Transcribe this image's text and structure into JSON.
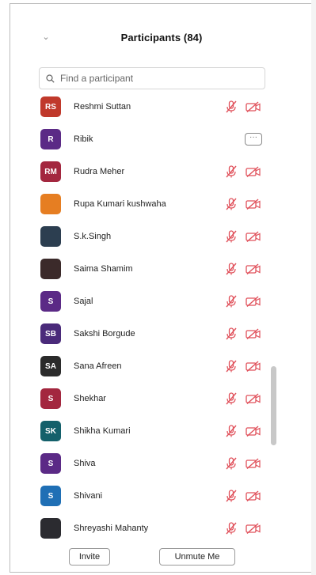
{
  "header": {
    "title": "Participants (84)"
  },
  "search": {
    "placeholder": "Find a participant"
  },
  "participants": [
    {
      "initials": "RS",
      "name": "Reshmi Suttan",
      "color": "#c0392b",
      "controls": "mic-cam"
    },
    {
      "initials": "R",
      "name": "Ribik",
      "color": "#5b2a86",
      "controls": "more"
    },
    {
      "initials": "RM",
      "name": "Rudra Meher",
      "color": "#a3273f",
      "controls": "mic-cam"
    },
    {
      "initials": "",
      "name": "Rupa Kumari kushwaha",
      "color": "#e67e22",
      "controls": "mic-cam"
    },
    {
      "initials": "",
      "name": "S.k.Singh",
      "color": "#2c3e50",
      "controls": "mic-cam"
    },
    {
      "initials": "",
      "name": "Saima Shamim",
      "color": "#3b2a2a",
      "controls": "mic-cam"
    },
    {
      "initials": "S",
      "name": "Sajal",
      "color": "#5b2a86",
      "controls": "mic-cam"
    },
    {
      "initials": "SB",
      "name": "Sakshi Borgude",
      "color": "#4a2a7a",
      "controls": "mic-cam"
    },
    {
      "initials": "SA",
      "name": "Sana Afreen",
      "color": "#2b2b2b",
      "controls": "mic-cam"
    },
    {
      "initials": "S",
      "name": "Shekhar",
      "color": "#a3273f",
      "controls": "mic-cam"
    },
    {
      "initials": "SK",
      "name": "Shikha Kumari",
      "color": "#14606b",
      "controls": "mic-cam"
    },
    {
      "initials": "S",
      "name": "Shiva",
      "color": "#5b2a86",
      "controls": "mic-cam"
    },
    {
      "initials": "S",
      "name": "Shivani",
      "color": "#1f6fb5",
      "controls": "mic-cam"
    },
    {
      "initials": "",
      "name": "Shreyashi Mahanty",
      "color": "#2b2b30",
      "controls": "mic-cam"
    }
  ],
  "footer": {
    "invite_label": "Invite",
    "unmute_label": "Unmute Me"
  },
  "icons": {
    "muted_mic": "muted-mic-icon",
    "video_off": "video-off-icon",
    "more": "more-icon",
    "search": "search-icon",
    "chevron": "chevron-down-icon"
  },
  "colors": {
    "icon_red": "#e0505a",
    "border": "#bdbdbd"
  }
}
